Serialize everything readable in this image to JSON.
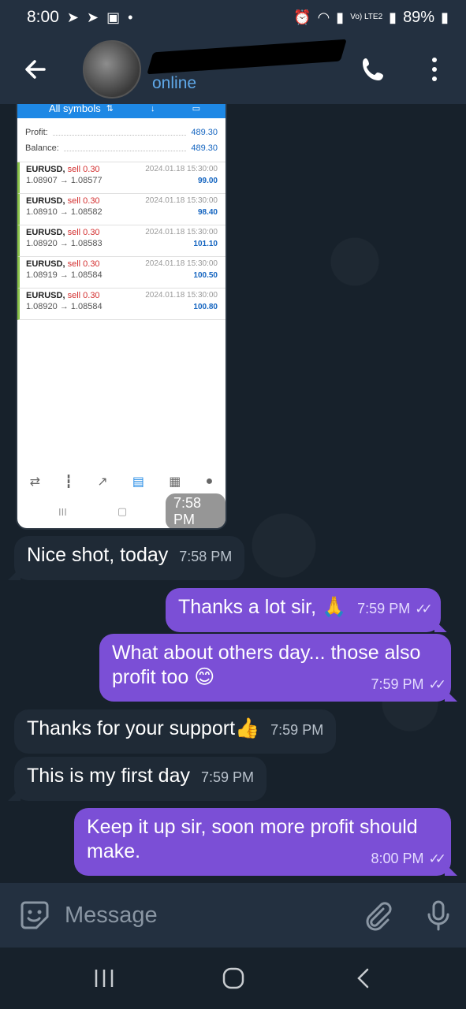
{
  "status_bar": {
    "time": "8:00",
    "signal_text": "Vo) LTE2",
    "battery": "89%"
  },
  "header": {
    "status": "online",
    "back_icon": "arrow-left-icon",
    "call_icon": "phone-icon",
    "menu_icon": "more-vert-icon"
  },
  "screenshot": {
    "tab_label": "All symbols",
    "profit_label": "Profit:",
    "profit_value": "489.30",
    "balance_label": "Balance:",
    "balance_value": "489.30",
    "trades": [
      {
        "symbol": "EURUSD,",
        "side": "sell 0.30",
        "prices": "1.08907 → 1.08577",
        "time": "2024.01.18 15:30:00",
        "profit": "99.00"
      },
      {
        "symbol": "EURUSD,",
        "side": "sell 0.30",
        "prices": "1.08910 → 1.08582",
        "time": "2024.01.18 15:30:00",
        "profit": "98.40"
      },
      {
        "symbol": "EURUSD,",
        "side": "sell 0.30",
        "prices": "1.08920 → 1.08583",
        "time": "2024.01.18 15:30:00",
        "profit": "101.10"
      },
      {
        "symbol": "EURUSD,",
        "side": "sell 0.30",
        "prices": "1.08919 → 1.08584",
        "time": "2024.01.18 15:30:00",
        "profit": "100.50"
      },
      {
        "symbol": "EURUSD,",
        "side": "sell 0.30",
        "prices": "1.08920 → 1.08584",
        "time": "2024.01.18 15:30:00",
        "profit": "100.80"
      }
    ],
    "nav_recent": "III",
    "nav_home": "▢",
    "sent_time": "7:58 PM"
  },
  "messages": [
    {
      "dir": "in",
      "text": "Nice shot, today",
      "time": "7:58 PM"
    },
    {
      "dir": "out",
      "text": "Thanks a lot sir, 🙏",
      "time": "7:59 PM"
    },
    {
      "dir": "out",
      "text": "What about others day... those also profit too 😊",
      "time": "7:59 PM"
    },
    {
      "dir": "in",
      "text": "Thanks for your support👍",
      "time": "7:59 PM"
    },
    {
      "dir": "in",
      "text": "This is my first day",
      "time": "7:59 PM"
    },
    {
      "dir": "out",
      "text": "Keep it up sir, soon more profit should make.",
      "time": "8:00 PM"
    }
  ],
  "input": {
    "placeholder": "Message"
  },
  "colors": {
    "outgoing_bubble": "#7b4fd6",
    "incoming_bubble": "#1f2a36",
    "header_bg": "#233040",
    "online_status": "#5fa8e8"
  }
}
